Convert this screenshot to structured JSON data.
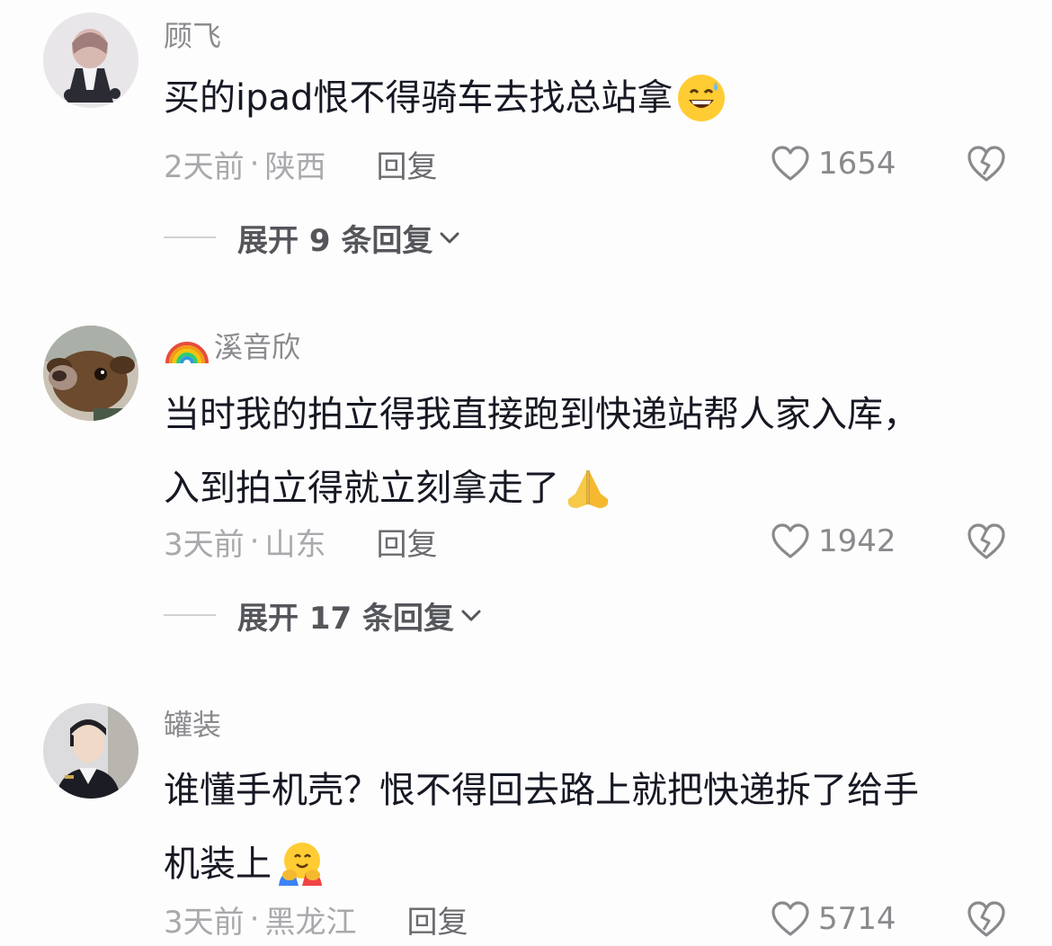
{
  "comments": [
    {
      "username": "顾飞",
      "lines": [
        "买的ipad恨不得骑车去找总站拿"
      ],
      "emoji": "grinning-sweat-emoji",
      "time": "2天前",
      "location": "陕西",
      "separator": "·",
      "reply_label": "回复",
      "likes": "1654",
      "expand_label": "展开 9 条回复"
    },
    {
      "username": "溪音欣",
      "lines": [
        "当时我的拍立得我直接跑到快递站帮人家入库，",
        "入到拍立得就立刻拿走了"
      ],
      "emoji": "praying-hands-emoji",
      "time": "3天前",
      "location": "山东",
      "separator": "·",
      "reply_label": "回复",
      "likes": "1942",
      "expand_label": "展开 17 条回复"
    },
    {
      "username": "罐装",
      "lines": [
        "谁懂手机壳？恨不得回去路上就把快递拆了给手",
        "机装上"
      ],
      "emoji": "hugging-face-emoji",
      "time": "3天前",
      "location": "黑龙江",
      "separator": "·",
      "reply_label": "回复",
      "likes": "5714"
    }
  ],
  "colors": {
    "text_primary": "#161823",
    "text_secondary": "#8a8a8e",
    "text_meta": "#a9a9ad",
    "background": "#fdfdfd"
  }
}
